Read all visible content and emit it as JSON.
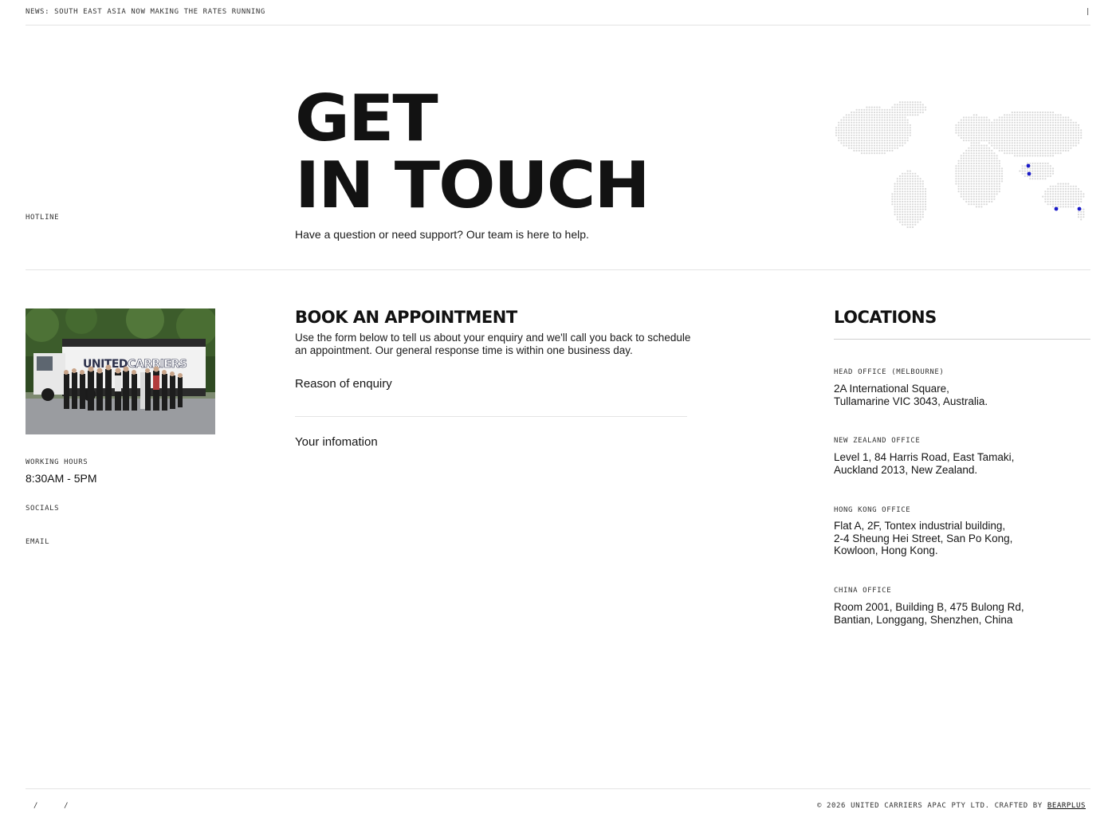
{
  "news": {
    "text": "NEWS: SOUTH EAST ASIA NOW MAKING THE RATES RUNNING",
    "pipe": "|"
  },
  "hero": {
    "line1": "GET",
    "line2": "IN TOUCH",
    "subtitle": "Have a question or need support? Our team is here to help."
  },
  "sidebar": {
    "hotline_label": "HOTLINE",
    "photo_banner_text": "UNITEDCARRIERS",
    "hours_label": "WORKING HOURS",
    "hours_value": "8:30AM - 5PM",
    "socials_label": "SOCIALS",
    "email_label": "EMAIL"
  },
  "appointment": {
    "title": "BOOK AN APPOINTMENT",
    "description": "Use the form below to tell us about your enquiry and we'll call you back to schedule an appointment. Our general response time is within one business day.",
    "reason_label": "Reason of enquiry",
    "info_label": "Your infomation"
  },
  "locations": {
    "title": "LOCATIONS",
    "offices": [
      {
        "label": "HEAD  OFFICE  (MELBOURNE)",
        "address": "2A International Square,\nTullamarine VIC 3043, Australia."
      },
      {
        "label": "NEW ZEALAND  OFFICE",
        "address": "Level 1, 84 Harris Road, East Tamaki,\nAuckland 2013, New Zealand."
      },
      {
        "label": "HONG KONG  OFFICE",
        "address": "Flat A, 2F, Tontex industrial building,\n2-4 Sheung Hei Street, San Po Kong,\nKowloon, Hong Kong."
      },
      {
        "label": "CHINA  OFFICE",
        "address": "Room 2001, Building B, 475 Bulong Rd,\nBantian, Longgang, Shenzhen, China"
      }
    ]
  },
  "footer": {
    "slash1": "/",
    "slash2": "/",
    "copyright": "© 2026 UNITED CARRIERS APAC PTY LTD. CRAFTED BY ",
    "crafted_link": "BEARPLUS"
  },
  "colors": {
    "accent_dot": "#1a1ac8",
    "map_dot": "#d9d9d9",
    "rule": "#e4e4e4",
    "text": "#111111"
  }
}
